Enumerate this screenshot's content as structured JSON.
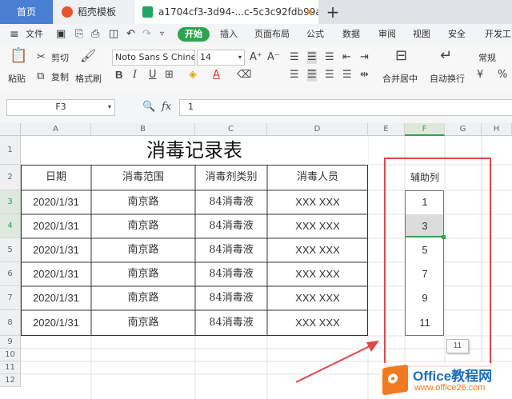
{
  "tabs": {
    "home": "首页",
    "template": "稻壳模板",
    "file": "a1704cf3-3d94-...c-5c3c92fdb99a",
    "new_tab": "+"
  },
  "menu": {
    "file": "文件",
    "items": [
      "开始",
      "插入",
      "页面布局",
      "公式",
      "数据",
      "审阅",
      "视图",
      "安全",
      "开发工"
    ]
  },
  "ribbon": {
    "paste": "粘贴",
    "cut": "剪切",
    "copy": "复制",
    "format_painter": "格式刷",
    "font_name": "Noto Sans S Chine",
    "font_size": "14",
    "merge_center": "合并居中",
    "wrap_text": "自动换行",
    "number_format": "常规"
  },
  "formula_bar": {
    "cell_ref": "F3",
    "fx": "fx",
    "value": "1"
  },
  "columns": [
    "A",
    "B",
    "C",
    "D",
    "E",
    "F",
    "G",
    "H"
  ],
  "rows": [
    "1",
    "2",
    "3",
    "4",
    "5",
    "6",
    "7",
    "8",
    "9",
    "10",
    "11",
    "12"
  ],
  "sheet": {
    "title": "消毒记录表",
    "headers": [
      "日期",
      "消毒范围",
      "消毒剂类别",
      "消毒人员"
    ],
    "rows": [
      [
        "2020/1/31",
        "南京路",
        "84消毒液",
        "XXX XXX"
      ],
      [
        "2020/1/31",
        "南京路",
        "84消毒液",
        "XXX XXX"
      ],
      [
        "2020/1/31",
        "南京路",
        "84消毒液",
        "XXX XXX"
      ],
      [
        "2020/1/31",
        "南京路",
        "84消毒液",
        "XXX XXX"
      ],
      [
        "2020/1/31",
        "南京路",
        "84消毒液",
        "XXX XXX"
      ],
      [
        "2020/1/31",
        "南京路",
        "84消毒液",
        "XXX XXX"
      ]
    ],
    "helper_header": "辅助列",
    "helper_values": [
      "1",
      "3",
      "5",
      "7",
      "9",
      "11"
    ],
    "fill_tooltip": "11"
  },
  "watermark": {
    "brand": "Office教程网",
    "url": "www.office26.com"
  },
  "colors": {
    "accent_green": "#2ea44f",
    "home_tab_blue": "#4a7fd4",
    "annotation_red": "#e04848",
    "watermark_orange": "#f07a1f"
  }
}
